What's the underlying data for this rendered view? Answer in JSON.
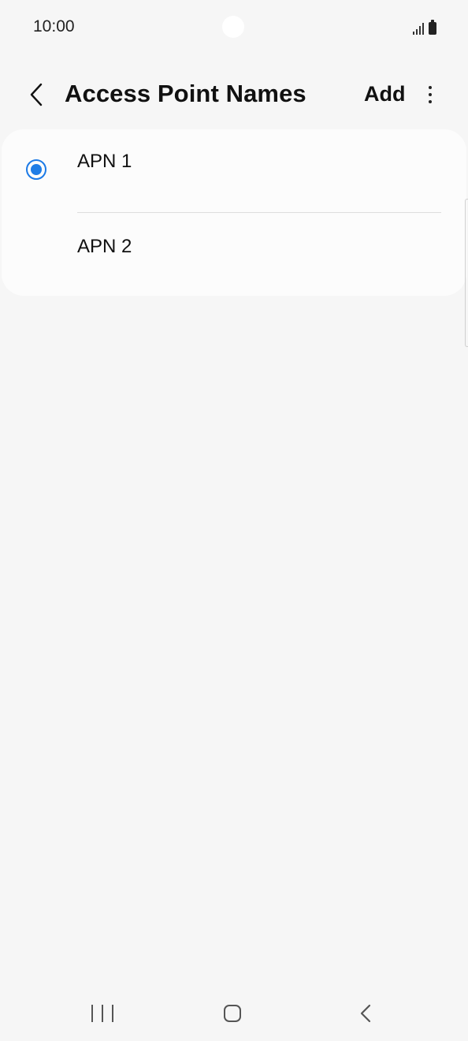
{
  "status_bar": {
    "time": "10:00",
    "icons": [
      "signal-icon",
      "battery-icon"
    ]
  },
  "header": {
    "title": "Access Point Names",
    "back_icon": "chevron-left-icon",
    "add_label": "Add",
    "more_icon": "more-vertical-icon"
  },
  "apn_list": {
    "items": [
      {
        "label": "APN 1",
        "selected": true
      },
      {
        "label": "APN 2",
        "selected": false
      }
    ]
  },
  "nav_bar": {
    "icons": [
      "recents-icon",
      "home-icon",
      "back-icon"
    ]
  },
  "colors": {
    "accent": "#1f7de6",
    "background": "#f6f6f6",
    "card": "#fcfcfc"
  }
}
